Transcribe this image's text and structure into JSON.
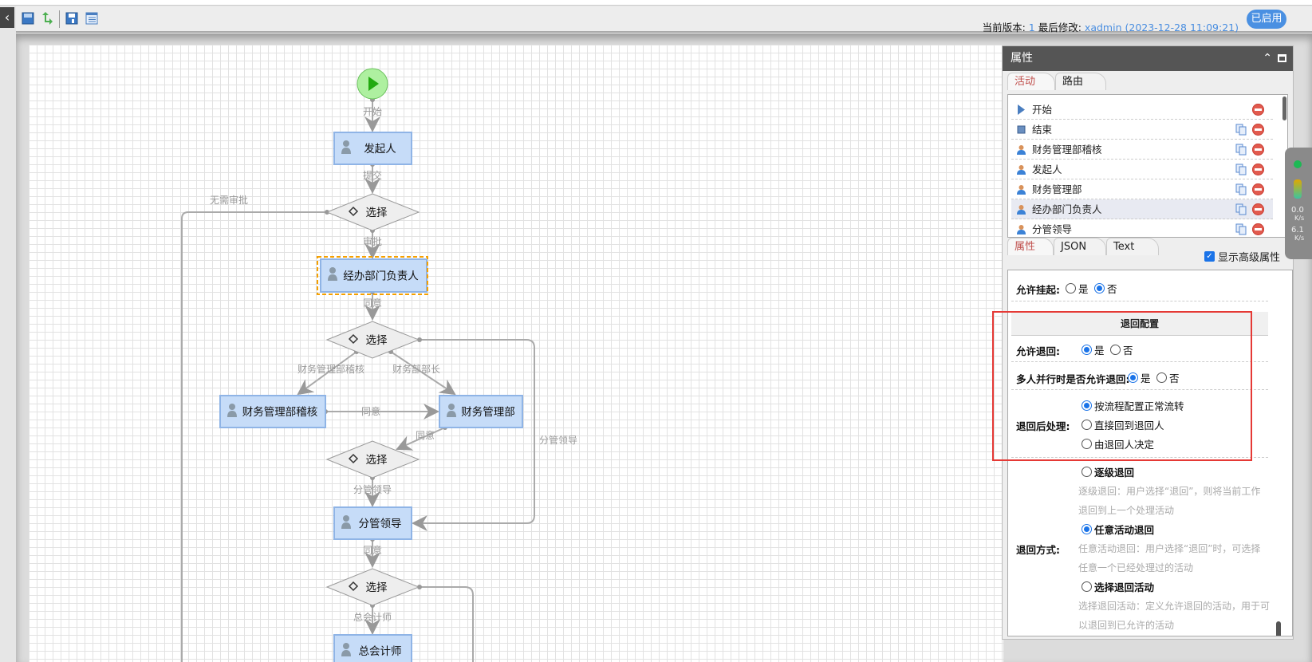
{
  "toolbar": {
    "icons": [
      "back-arrow-icon",
      "save-icon",
      "publish-icon",
      "save-as-icon",
      "list-icon"
    ],
    "version_label": "当前版本:",
    "version": "1",
    "modified_label": "最后修改:",
    "modified_by": "xadmin",
    "modified_time": "(2023-12-28 11:09:21)",
    "status_button": "已启用"
  },
  "diagram": {
    "nodes": {
      "start": "开始",
      "initiator": "发起人",
      "choice": "选择",
      "dept_head": "经办部门负责人",
      "finance_audit": "财务管理部稽核",
      "finance": "财务管理部",
      "leader": "分管领导",
      "chief_accountant": "总会计师"
    },
    "edges": {
      "start": "开始",
      "submit": "提交",
      "no_approval": "无需审批",
      "approve": "审批",
      "agree": "同意",
      "to_finance_audit": "财务管理部稽核",
      "to_finance_head": "财务部部长",
      "to_leader": "分管领导",
      "to_chief": "总会计师"
    },
    "selected": "经办部门负责人"
  },
  "panel": {
    "title": "属性",
    "tabs": [
      "活动",
      "路由"
    ],
    "activities": [
      {
        "name": "开始",
        "icon": "play-icon"
      },
      {
        "name": "结束",
        "icon": "stop-icon"
      },
      {
        "name": "财务管理部稽核",
        "icon": "user-icon"
      },
      {
        "name": "发起人",
        "icon": "user-icon"
      },
      {
        "name": "财务管理部",
        "icon": "user-icon"
      },
      {
        "name": "经办部门负责人",
        "icon": "user-icon",
        "selected": true
      },
      {
        "name": "分管领导",
        "icon": "user-icon"
      }
    ],
    "prop_tabs": [
      "属性",
      "JSON",
      "Text"
    ],
    "show_advanced": "显示高级属性",
    "show_advanced_checked": true,
    "allow_suspend": {
      "label": "允许挂起:",
      "yes": "是",
      "no": "否",
      "value": "否"
    },
    "return_section": "退回配置",
    "allow_return": {
      "label": "允许退回:",
      "yes": "是",
      "no": "否",
      "value": "是"
    },
    "parallel_return": {
      "label": "多人并行时是否允许退回:",
      "yes": "是",
      "no": "否",
      "value": "是"
    },
    "after_return": {
      "label": "退回后处理:",
      "options": [
        "按流程配置正常流转",
        "直接回到退回人",
        "由退回人决定"
      ],
      "value": "按流程配置正常流转"
    },
    "return_mode": {
      "label": "退回方式:",
      "value": "任意活动退回",
      "options": [
        {
          "name": "逐级退回",
          "desc": [
            "逐级退回：用户选择“退回”，则将当前工作",
            "退回到上一个处理活动"
          ]
        },
        {
          "name": "任意活动退回",
          "desc": [
            "任意活动退回：用户选择“退回”时，可选择",
            "任意一个已经处理过的活动"
          ]
        },
        {
          "name": "选择退回活动",
          "desc": [
            "选择退回活动：定义允许退回的活动，用于可",
            "以退回到已允许的活动"
          ]
        }
      ]
    }
  },
  "net_widget": {
    "up": "0.0",
    "down": "6.1",
    "unit": "K/s"
  }
}
